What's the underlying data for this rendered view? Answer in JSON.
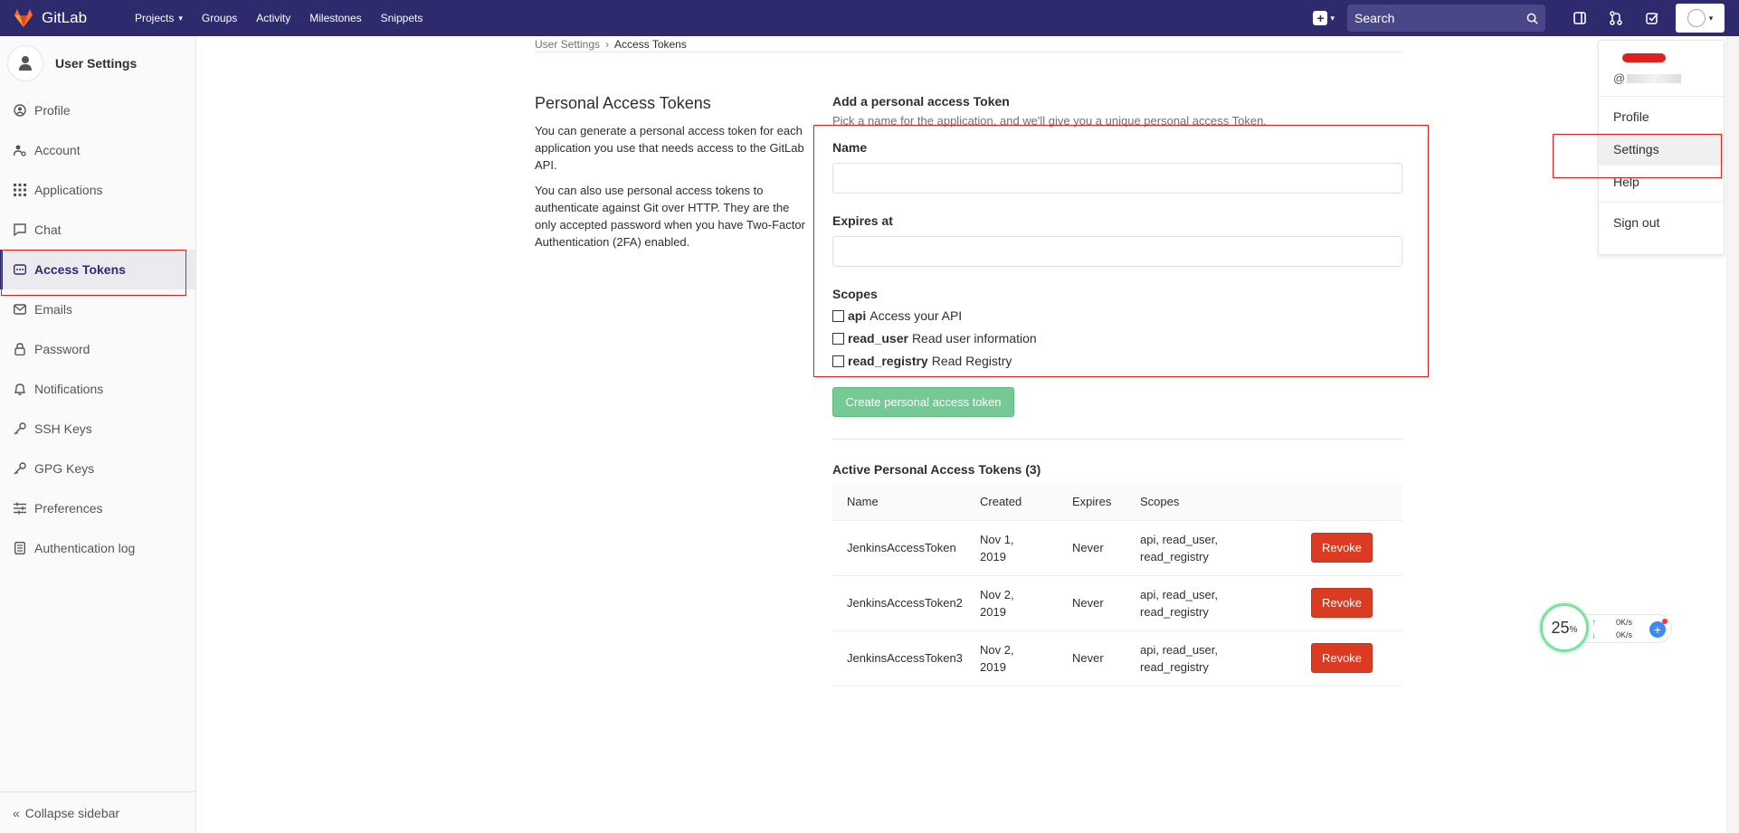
{
  "navbar": {
    "brand": "GitLab",
    "links": [
      "Projects",
      "Groups",
      "Activity",
      "Milestones",
      "Snippets"
    ],
    "search_placeholder": "Search",
    "bg_color": "#2d2a6e"
  },
  "sidebar": {
    "title": "User Settings",
    "items": [
      {
        "label": "Profile",
        "icon": "profile-icon"
      },
      {
        "label": "Account",
        "icon": "account-icon"
      },
      {
        "label": "Applications",
        "icon": "applications-icon"
      },
      {
        "label": "Chat",
        "icon": "chat-icon"
      },
      {
        "label": "Access Tokens",
        "icon": "token-icon",
        "active": true
      },
      {
        "label": "Emails",
        "icon": "email-icon"
      },
      {
        "label": "Password",
        "icon": "lock-icon"
      },
      {
        "label": "Notifications",
        "icon": "bell-icon"
      },
      {
        "label": "SSH Keys",
        "icon": "key-icon"
      },
      {
        "label": "GPG Keys",
        "icon": "key-icon"
      },
      {
        "label": "Preferences",
        "icon": "sliders-icon"
      },
      {
        "label": "Authentication log",
        "icon": "log-icon"
      }
    ],
    "collapse": "Collapse sidebar"
  },
  "breadcrumb": {
    "parent": "User Settings",
    "sep": "›",
    "current": "Access Tokens"
  },
  "intro": {
    "title": "Personal Access Tokens",
    "p1": "You can generate a personal access token for each application you use that needs access to the GitLab API.",
    "p2": "You can also use personal access tokens to authenticate against Git over HTTP. They are the only accepted password when you have Two-Factor Authentication (2FA) enabled."
  },
  "form": {
    "heading": "Add a personal access Token",
    "subheading": "Pick a name for the application, and we'll give you a unique personal access Token.",
    "name_label": "Name",
    "name_value": "",
    "expires_label": "Expires at",
    "expires_value": "",
    "scopes_label": "Scopes",
    "scopes": [
      {
        "key": "api",
        "desc": "Access your API"
      },
      {
        "key": "read_user",
        "desc": "Read user information"
      },
      {
        "key": "read_registry",
        "desc": "Read Registry"
      }
    ],
    "submit": "Create personal access token"
  },
  "active": {
    "heading": "Active Personal Access Tokens (3)",
    "columns": [
      "Name",
      "Created",
      "Expires",
      "Scopes"
    ],
    "rows": [
      {
        "name": "JenkinsAccessToken",
        "created_1": "Nov 1,",
        "created_2": "2019",
        "expires": "Never",
        "scopes_1": "api, read_user,",
        "scopes_2": "read_registry",
        "action": "Revoke"
      },
      {
        "name": "JenkinsAccessToken2",
        "created_1": "Nov 2,",
        "created_2": "2019",
        "expires": "Never",
        "scopes_1": "api, read_user,",
        "scopes_2": "read_registry",
        "action": "Revoke"
      },
      {
        "name": "JenkinsAccessToken3",
        "created_1": "Nov 2,",
        "created_2": "2019",
        "expires": "Never",
        "scopes_1": "api, read_user,",
        "scopes_2": "read_registry",
        "action": "Revoke"
      }
    ]
  },
  "user_menu": {
    "handle_prefix": "@",
    "items": [
      "Profile",
      "Settings",
      "Help",
      "Sign out"
    ]
  },
  "speed_widget": {
    "percent": "25",
    "percent_sign": "%",
    "up": "0K/s",
    "down": "0K/s",
    "up_arrow": "↑",
    "down_arrow": "↓"
  }
}
